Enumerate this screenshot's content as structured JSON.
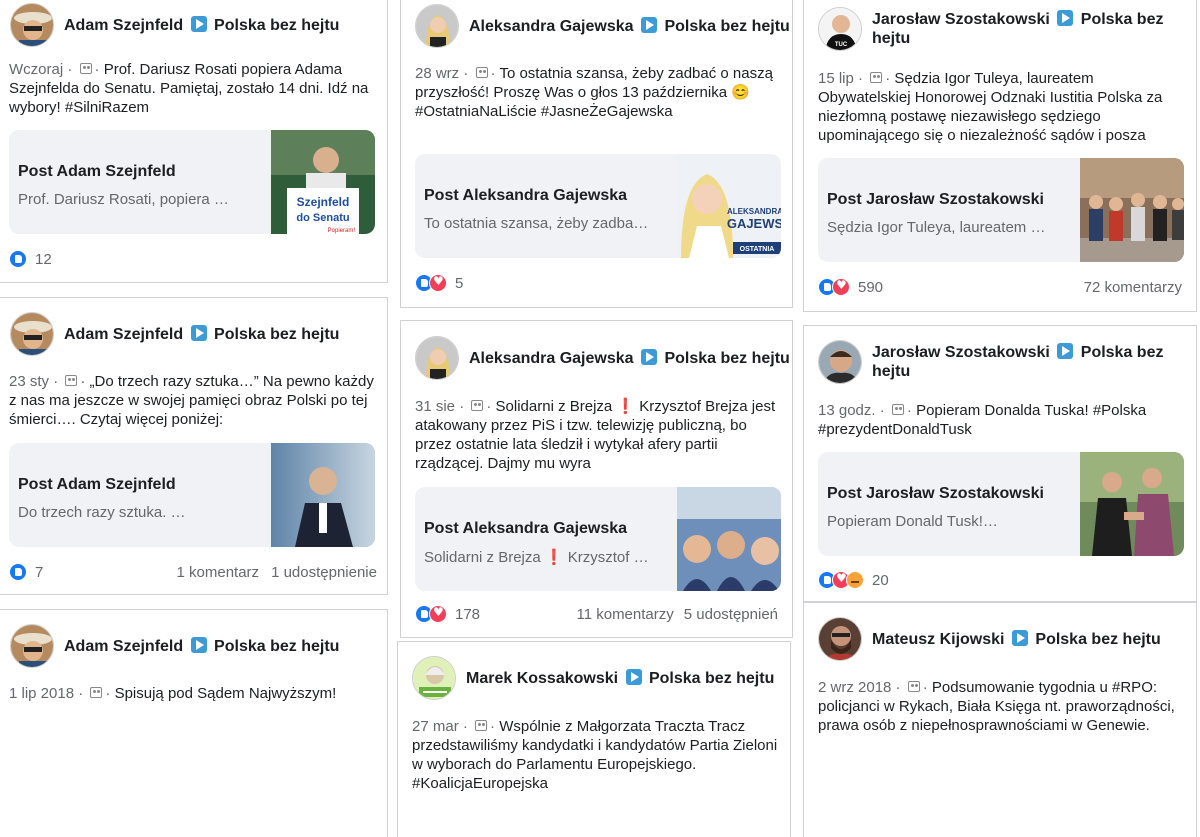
{
  "page_label": "Polska bez hejtu",
  "posts": [
    {
      "author": "Adam Szejnfeld",
      "date": "Wczoraj",
      "text": "Prof. Dariusz Rosati popiera Adama Szejnfelda do Senatu. Pamiętaj, zostało 14 dni. Idź na wybory!  #SilniRazem",
      "card_title": "Post Adam Szejnfeld",
      "card_desc": "Prof. Dariusz Rosati, popiera …",
      "thumb_text": "Szejnfeld\ndo Senatu",
      "thumb_sub": "Popieram!",
      "reactions": "12",
      "comments": "",
      "shares": ""
    },
    {
      "author": "Adam Szejnfeld",
      "date": "23 sty",
      "text": "„Do trzech razy sztuka…” Na pewno każdy z nas ma jeszcze w swojej pamięci obraz Polski po tej śmierci…. Czytaj więcej poniżej:",
      "card_title": "Post Adam Szejnfeld",
      "card_desc": "Do trzech razy sztuka. …",
      "reactions": "7",
      "comments": "1 komentarz",
      "shares": "1 udostępnienie"
    },
    {
      "author": "Adam Szejnfeld",
      "date": "1 lip 2018",
      "text": "Spisują pod Sądem Najwyższym!"
    },
    {
      "author": "Aleksandra Gajewska",
      "date": "28 wrz",
      "text": "To ostatnia szansa, żeby zadbać o naszą przyszłość! Proszę Was o głos 13 października 😊  #OstatniaNaLiście #JasneŻeGajewska",
      "card_title": "Post Aleksandra Gajewska",
      "card_desc": "To ostatnia szansa, żeby zadba…",
      "thumb_text": "ALEKSANDRA\nGAJEWS",
      "thumb_sub": "OSTATNIA",
      "reactions": "5",
      "comments": "",
      "shares": ""
    },
    {
      "author": "Aleksandra Gajewska",
      "date": "31 sie",
      "text": "Solidarni z Brejza ❗ Krzysztof Brejza jest atakowany przez PiS i tzw. telewizję publiczną, bo przez ostatnie lata śledził i wytykał afery partii rządzącej. Dajmy mu wyra",
      "card_title": "Post Aleksandra Gajewska",
      "card_desc": "Solidarni z Brejza ❗ Krzysztof …",
      "reactions": "178",
      "comments": "11 komentarzy",
      "shares": "5 udostępnień"
    },
    {
      "author": "Marek Kossakowski",
      "date": "27 mar",
      "text": "Wspólnie z Małgorzata Traczta Tracz przedstawiliśmy kandydatki i kandydatów Partia Zieloni w wyborach do Parlamentu Europejskiego. #KoalicjaEuropejska"
    },
    {
      "author": "Jarosław Szostakowski",
      "date": "15 lip",
      "text": "Sędzia Igor Tuleya, laureatem Obywatelskiej Honorowej Odznaki  Iustitia Polska za niezłomną postawę niezawisłego sędziego upominającego się o niezależność sądów i posza",
      "card_title": "Post Jarosław Szostakowski",
      "card_desc": "Sędzia Igor Tuleya, laureatem …",
      "reactions": "590",
      "comments": "72 komentarzy",
      "shares": ""
    },
    {
      "author": "Jarosław Szostakowski",
      "date": "13 godz.",
      "text": "Popieram Donalda Tuska! #Polska #prezydentDonaldTusk",
      "card_title": "Post Jarosław Szostakowski",
      "card_desc": "Popieram Donald Tusk!…",
      "reactions": "20",
      "comments": "",
      "shares": ""
    },
    {
      "author": "Mateusz Kijowski",
      "date": "2 wrz 2018",
      "text": "Podsumowanie tygodnia u #RPO: policjanci w Rykach, Biała Księga nt. praworządności, prawa osób z niepełnosprawnościami w Genewie."
    }
  ],
  "colors": {
    "like": "#1877f2",
    "love": "#f33e58",
    "angry": "#f7a33a",
    "page_arrow": "#3b9bd9",
    "card_bg": "#f0f2f5"
  }
}
